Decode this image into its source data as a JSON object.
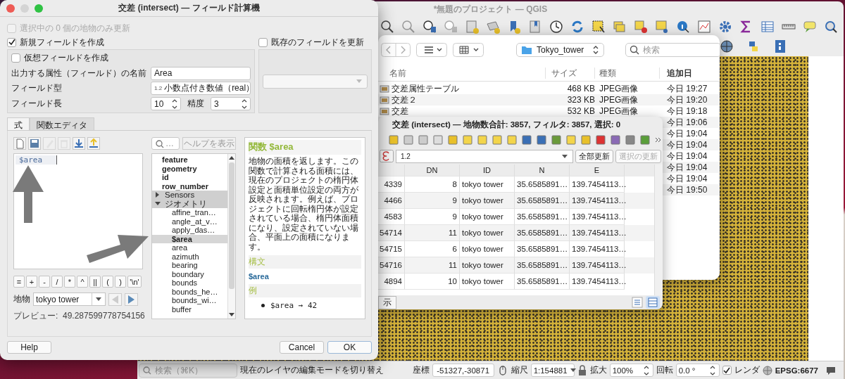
{
  "qgis_window": {
    "title": "*無題のプロジェクト — QGIS",
    "status_bar": {
      "search_placeholder": "検索（⌘K）",
      "message": "現在のレイヤの編集モードを切り替え",
      "coordinate_label": "座標",
      "coordinate": "-51327,-30871",
      "scale_label": "縮尺",
      "scale": "1:154881",
      "magnifier_label": "拡大",
      "magnifier": "100%",
      "rotation_label": "回転",
      "rotation": "0.0 °",
      "render_checked": true,
      "render_label": "レンダ",
      "crs": "EPSG:6677"
    }
  },
  "finder_window": {
    "path": "Tokyo_tower",
    "search_placeholder": "検索",
    "columns": [
      "名前",
      "サイズ",
      "種類",
      "追加日"
    ],
    "rows": [
      {
        "name": "交差属性テーブル",
        "size": "468 KB",
        "kind": "JPEG画像",
        "date": "今日 19:27"
      },
      {
        "name": "交差２",
        "size": "323 KB",
        "kind": "JPEG画像",
        "date": "今日 19:20"
      },
      {
        "name": "交差",
        "size": "532 KB",
        "kind": "JPEG画像",
        "date": "今日 19:18"
      },
      {
        "date": "今日 19:06"
      },
      {
        "date": "今日 19:04"
      },
      {
        "date": "今日 19:04"
      },
      {
        "date": "今日 19:04"
      },
      {
        "date": "今日 19:04"
      },
      {
        "date": "今日 19:04"
      },
      {
        "date": "今日 19:50"
      }
    ]
  },
  "attribute_table_window": {
    "title": "交差 (intersect) — 地物数合計: 3857, フィルタ: 3857, 選択: 0",
    "expression": "1.2",
    "buttons": [
      {
        "label": "全部更新",
        "disabled": false
      },
      {
        "label": "選択の更新",
        "disabled": true
      }
    ],
    "columns": [
      "DN",
      "ID",
      "N",
      "E"
    ],
    "rows": [
      {
        "column_1": "4339",
        "cells": [
          "8",
          "tokyo tower",
          "35.6585891…",
          "139.7454113…"
        ]
      },
      {
        "column_1": "4466",
        "cells": [
          "9",
          "tokyo tower",
          "35.6585891…",
          "139.7454113…"
        ]
      },
      {
        "column_1": "4583",
        "cells": [
          "9",
          "tokyo tower",
          "35.6585891…",
          "139.7454113…"
        ]
      },
      {
        "column_1": "54714",
        "cells": [
          "11",
          "tokyo tower",
          "35.6585891…",
          "139.7454113…"
        ]
      },
      {
        "column_1": "54715",
        "cells": [
          "6",
          "tokyo tower",
          "35.6585891…",
          "139.7454113…"
        ]
      },
      {
        "column_1": "54716",
        "cells": [
          "11",
          "tokyo tower",
          "35.6585891…",
          "139.7454113…"
        ]
      },
      {
        "column_1": "4894",
        "cells": [
          "10",
          "tokyo tower",
          "35.6585891…",
          "139.7454113…"
        ]
      }
    ],
    "footer": "示"
  },
  "field_calculator": {
    "title": "交差 (intersect) — フィールド計算機",
    "only_selected": {
      "label": "選択中の 0 個の地物のみ更新",
      "checked": false,
      "disabled": true
    },
    "create_new": {
      "label": "新規フィールドを作成",
      "checked": true
    },
    "update_existing": {
      "label": "既存のフィールドを更新",
      "checked": false
    },
    "virtual": {
      "label": "仮想フィールドを作成",
      "checked": false
    },
    "name_label": "出力する属性（フィールド）の名前",
    "name_value": "Area",
    "type_label": "フィールド型",
    "type_badge": "1.2",
    "type_value": "小数点付き数値（real）",
    "length_label": "フィールド長",
    "length_value": "10",
    "precision_label": "精度",
    "precision_value": "3",
    "tabs": [
      {
        "label": "式",
        "selected": true
      },
      {
        "label": "関数エディタ",
        "selected": false
      }
    ],
    "expression": "$area",
    "operators": [
      "=",
      "+",
      "-",
      "/",
      "*",
      "^",
      "||",
      "(",
      ")",
      "'\\n'"
    ],
    "feature_label": "地物",
    "feature_value": "tokyo tower",
    "prev_disabled": true,
    "preview": "プレビュー:  49.287599778754156",
    "search_placeholder": "…",
    "help_button": "ヘルプを表示",
    "tree": [
      {
        "kind": "field",
        "label": "feature"
      },
      {
        "kind": "field",
        "label": "geometry"
      },
      {
        "kind": "field",
        "label": "id"
      },
      {
        "kind": "field",
        "label": "row_number"
      },
      {
        "kind": "group",
        "label": "Sensors",
        "expanded": false
      },
      {
        "kind": "group",
        "label": "ジオメトリ",
        "expanded": true,
        "children": [
          {
            "label": "affine_tran…",
            "selected": false
          },
          {
            "label": "angle_at_v…",
            "selected": false
          },
          {
            "label": "apply_das…",
            "selected": false
          },
          {
            "label": "$area",
            "selected": true
          },
          {
            "label": "area",
            "selected": false
          },
          {
            "label": "azimuth",
            "selected": false
          },
          {
            "label": "bearing",
            "selected": false
          },
          {
            "label": "boundary",
            "selected": false
          },
          {
            "label": "bounds",
            "selected": false
          },
          {
            "label": "bounds_he…",
            "selected": false
          },
          {
            "label": "bounds_wi…",
            "selected": false
          },
          {
            "label": "buffer",
            "selected": false
          }
        ]
      }
    ],
    "help": {
      "title": "関数 $area",
      "body": "地物の面積を返します。この関数で計算される面積には、現在のプロジェクトの楕円体設定と面積単位設定の両方が反映されます。例えば、プロジェクトに回転楕円体が設定されている場合、楕円体面積になり、設定されていない場合、平面上の面積になります。",
      "syntax_heading": "構文",
      "syntax": "$area",
      "example_heading": "例",
      "examples": [
        "$area → 42"
      ]
    },
    "buttons": {
      "help": "Help",
      "cancel": "Cancel",
      "ok": "OK"
    }
  }
}
